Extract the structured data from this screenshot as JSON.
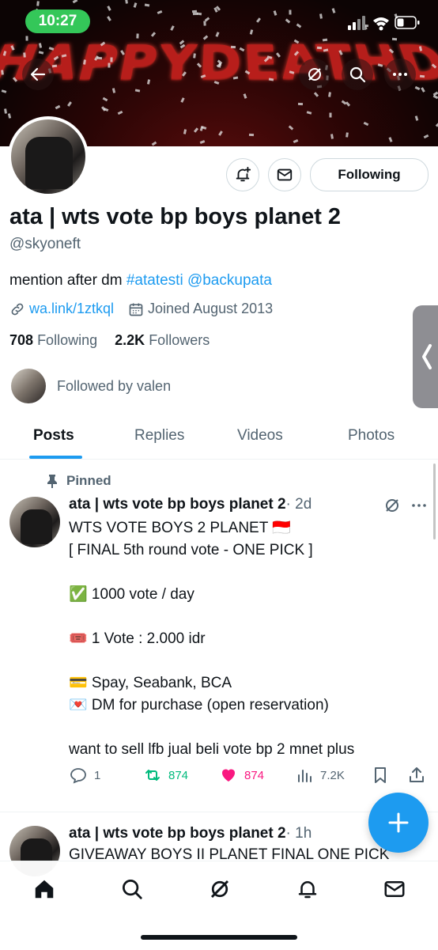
{
  "status_bar": {
    "time": "10:27"
  },
  "banner": {
    "text": "HAPPYDEATHDAY"
  },
  "profile": {
    "name": "ata | wts vote bp boys planet 2",
    "handle": "@skyoneft",
    "bio_text": "mention after dm ",
    "bio_hashtag": "#atatesti",
    "bio_mention": "@backupata",
    "website": "wa.link/1ztkql",
    "joined": "Joined August 2013",
    "following_count": "708",
    "following_label": "Following",
    "followers_count": "2.2K",
    "followers_label": "Followers",
    "followed_by": "Followed by valen",
    "follow_button": "Following"
  },
  "tabs": [
    {
      "label": "Posts",
      "active": true
    },
    {
      "label": "Replies",
      "active": false
    },
    {
      "label": "Videos",
      "active": false
    },
    {
      "label": "Photos",
      "active": false
    }
  ],
  "pinned_post": {
    "pinned_label": "Pinned",
    "author": "ata | wts vote bp boys planet 2",
    "time": "· 2d",
    "text": "WTS VOTE BOYS 2 PLANET 🇮🇩\n[ FINAL 5th round vote - ONE PICK ]\n\n✅ 1000 vote / day\n\n🎟️ 1 Vote : 2.000 idr\n\n💳 Spay, Seabank, BCA\n💌 DM for purchase (open reservation)\n\nwant to sell lfb jual beli vote bp 2 mnet plus",
    "replies": "1",
    "reposts": "874",
    "likes": "874",
    "views": "7.2K"
  },
  "second_post": {
    "author": "ata | wts vote bp boys planet 2",
    "time": "· 1h",
    "text": "GIVEAWAY BOYS II PLANET FINAL ONE PICK"
  },
  "colors": {
    "accent": "#1d9bf0",
    "repost": "#00ba7c",
    "like": "#f91880",
    "status_time_bg": "#34c759"
  },
  "icons": [
    "back-arrow-icon",
    "grok-icon",
    "search-icon",
    "more-icon",
    "add-notification-icon",
    "message-icon",
    "link-icon",
    "calendar-icon",
    "pin-icon",
    "reply-icon",
    "repost-icon",
    "heart-icon",
    "views-icon",
    "bookmark-icon",
    "share-icon",
    "plus-icon",
    "home-icon",
    "explore-icon",
    "grok-nav-icon",
    "notifications-icon",
    "messages-nav-icon"
  ]
}
